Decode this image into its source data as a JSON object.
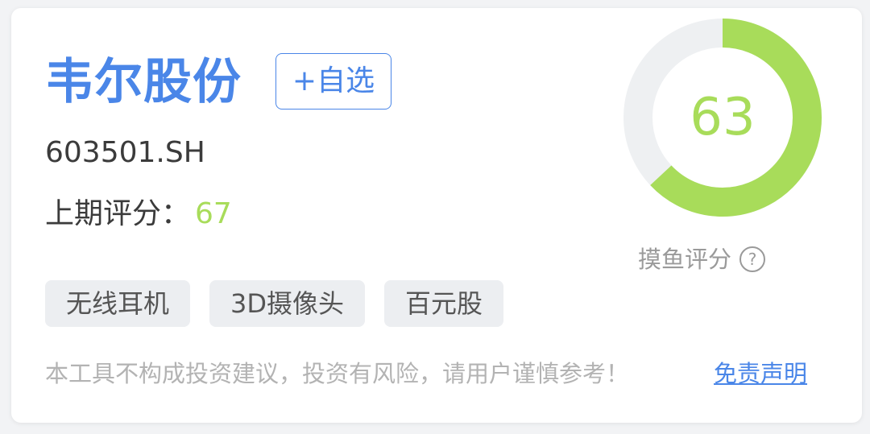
{
  "stock": {
    "name": "韦尔股份",
    "code": "603501.SH",
    "watch_label": "+自选"
  },
  "previous_score": {
    "label": "上期评分：",
    "value": "67"
  },
  "tags": [
    "无线耳机",
    "3D摄像头",
    "百元股"
  ],
  "gauge": {
    "score": 63,
    "max": 100,
    "label": "摸鱼评分",
    "help_icon": "question-circle-icon",
    "help_glyph": "?"
  },
  "disclaimer": {
    "text": "本工具不构成投资建议，投资有风险，请用户谨慎参考！",
    "link": "免责声明"
  },
  "colors": {
    "brand_blue": "#4a86e8",
    "score_green": "#a8dc5a",
    "track_gray": "#eef0f2",
    "tag_bg": "#eceef1"
  }
}
